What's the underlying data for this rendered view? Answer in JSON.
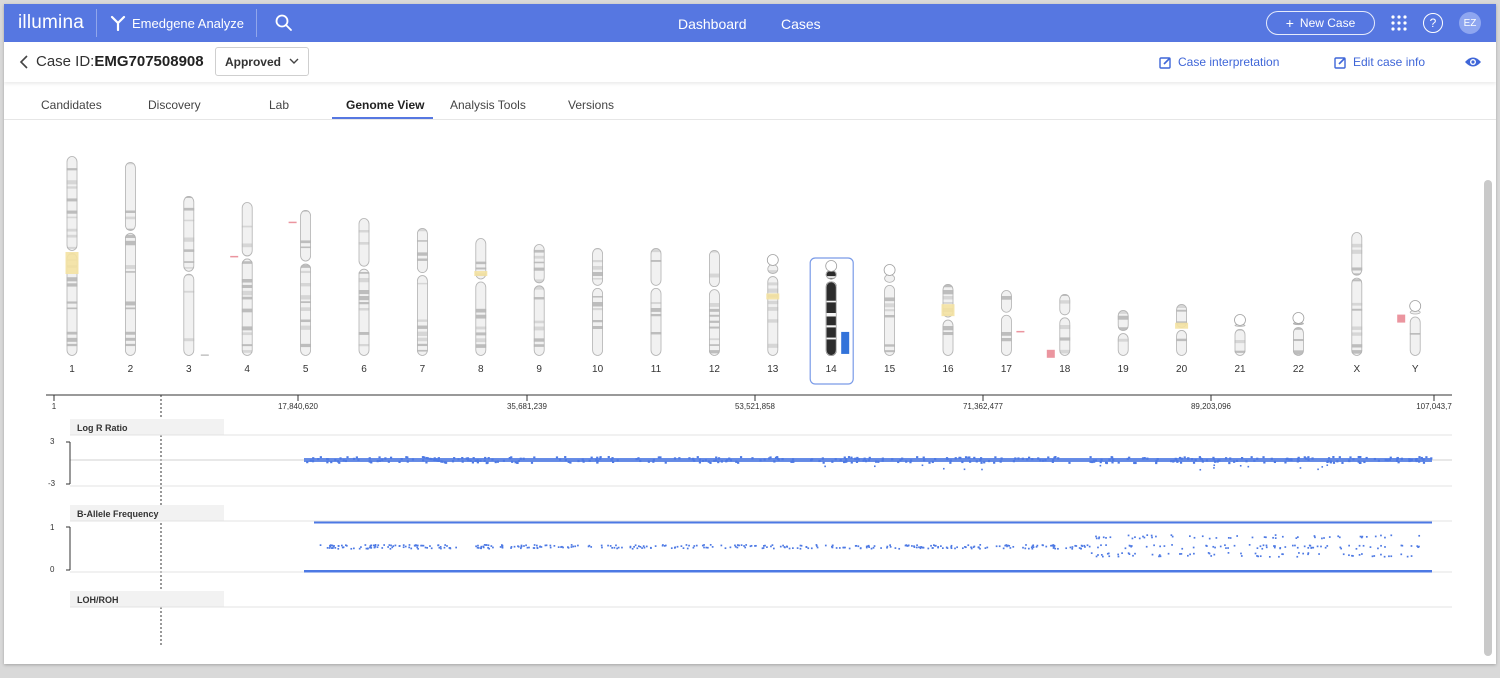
{
  "topbar": {
    "brand": "illumina",
    "app_name": "Emedgene Analyze",
    "nav": [
      "Dashboard",
      "Cases"
    ],
    "new_case_label": "New Case",
    "help_label": "?",
    "avatar_initials": "EZ"
  },
  "case": {
    "id_prefix": "Case ID:",
    "id": "EMG707508908",
    "status": "Approved",
    "interpretation_label": "Case interpretation",
    "edit_label": "Edit case info"
  },
  "tabs": [
    "Candidates",
    "Discovery",
    "Lab",
    "Genome View",
    "Analysis Tools",
    "Versions"
  ],
  "active_tab": "Genome View",
  "chromosomes": [
    {
      "label": "1",
      "relsize": 1.0
    },
    {
      "label": "2",
      "relsize": 0.97
    },
    {
      "label": "3",
      "relsize": 0.8
    },
    {
      "label": "4",
      "relsize": 0.77
    },
    {
      "label": "5",
      "relsize": 0.73
    },
    {
      "label": "6",
      "relsize": 0.69
    },
    {
      "label": "7",
      "relsize": 0.64
    },
    {
      "label": "8",
      "relsize": 0.59
    },
    {
      "label": "9",
      "relsize": 0.56
    },
    {
      "label": "10",
      "relsize": 0.54
    },
    {
      "label": "11",
      "relsize": 0.54
    },
    {
      "label": "12",
      "relsize": 0.53
    },
    {
      "label": "13",
      "relsize": 0.46
    },
    {
      "label": "14",
      "relsize": 0.43
    },
    {
      "label": "15",
      "relsize": 0.41
    },
    {
      "label": "16",
      "relsize": 0.36
    },
    {
      "label": "17",
      "relsize": 0.33
    },
    {
      "label": "18",
      "relsize": 0.31
    },
    {
      "label": "19",
      "relsize": 0.23
    },
    {
      "label": "20",
      "relsize": 0.26
    },
    {
      "label": "21",
      "relsize": 0.16
    },
    {
      "label": "22",
      "relsize": 0.17
    },
    {
      "label": "X",
      "relsize": 0.62
    },
    {
      "label": "Y",
      "relsize": 0.23
    }
  ],
  "selected_chromosome": "14",
  "colors": {
    "accent": "#5677e1",
    "link": "#3f66d8",
    "dots": "#4d79e4",
    "highlight_yellow": "#f4e2a2",
    "highlight_red": "#e98a95",
    "selected_marker": "#1d64d6"
  },
  "ruler": {
    "ticks": [
      "1",
      "17,840,620",
      "35,681,239",
      "53,521,858",
      "71,362,477",
      "89,203,096",
      "107,043,7"
    ]
  },
  "tracks": {
    "lrr": {
      "label": "Log R Ratio",
      "axis_top": "3",
      "axis_bottom": "-3"
    },
    "baf": {
      "label": "B-Allele Frequency",
      "axis_top": "1",
      "axis_bottom": "0"
    },
    "loh": {
      "label": "LOH/ROH"
    }
  }
}
